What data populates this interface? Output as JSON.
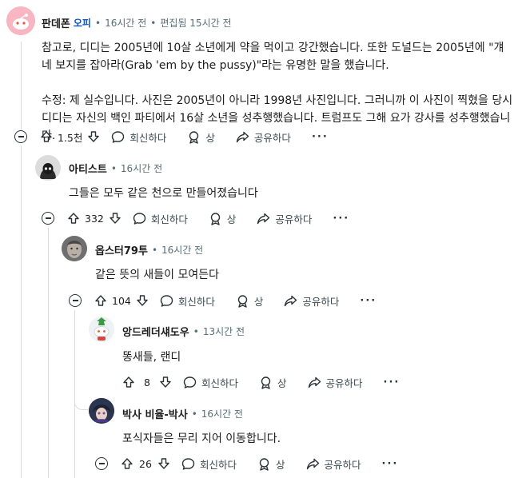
{
  "comments": [
    {
      "author": "판데폰",
      "op_badge": "오피",
      "time": "16시간 전",
      "edited": "편집됨 15시간 전",
      "paragraphs": [
        "참고로, 디디는 2005년에 10살 소년에게 약을 먹이고 강간했습니다. 또한 도널드는 2005년에 \"걔네 보지를 잡아라(Grab 'em by the pussy)\"라는 유명한 말을 했습니다.",
        "수정: 제 실수입니다. 사진은 2005년이 아니라 1998년 사진입니다. 그러니까 이 사진이 찍혔을 당시 디디는 자신의 백인 파티에서 16살 소년을 성추행했습니다. 트럼프도 그해 요가 강사를 성추행했습니다."
      ],
      "score": "1.5천"
    },
    {
      "author": "아티스트",
      "time": "16시간 전",
      "paragraphs": [
        "그들은 모두 같은 천으로 만들어졌습니다"
      ],
      "score": "332"
    },
    {
      "author": "옵스터79투",
      "time": "16시간 전",
      "paragraphs": [
        "같은 뜻의 새들이 모여든다"
      ],
      "score": "104"
    },
    {
      "author": "앙드레더섀도우",
      "time": "13시간 전",
      "paragraphs": [
        "똥새들, 랜디"
      ],
      "score": "8"
    },
    {
      "author": "박사 비율-박사",
      "time": "16시간 전",
      "paragraphs": [
        "포식자들은 무리 지어 이동합니다."
      ],
      "score": "26"
    }
  ],
  "actions": {
    "reply": "회신하다",
    "award": "상",
    "share": "공유하다",
    "more": "···"
  },
  "colors": {
    "op_badge": "#0a52c7",
    "meta": "#576f76",
    "thread_line": "#d9dde0",
    "op_avatar_bg": "#f7b6c2"
  },
  "icons": [
    "upvote-icon",
    "downvote-icon",
    "reply-icon",
    "award-icon",
    "share-icon",
    "collapse-icon",
    "more-icon"
  ]
}
